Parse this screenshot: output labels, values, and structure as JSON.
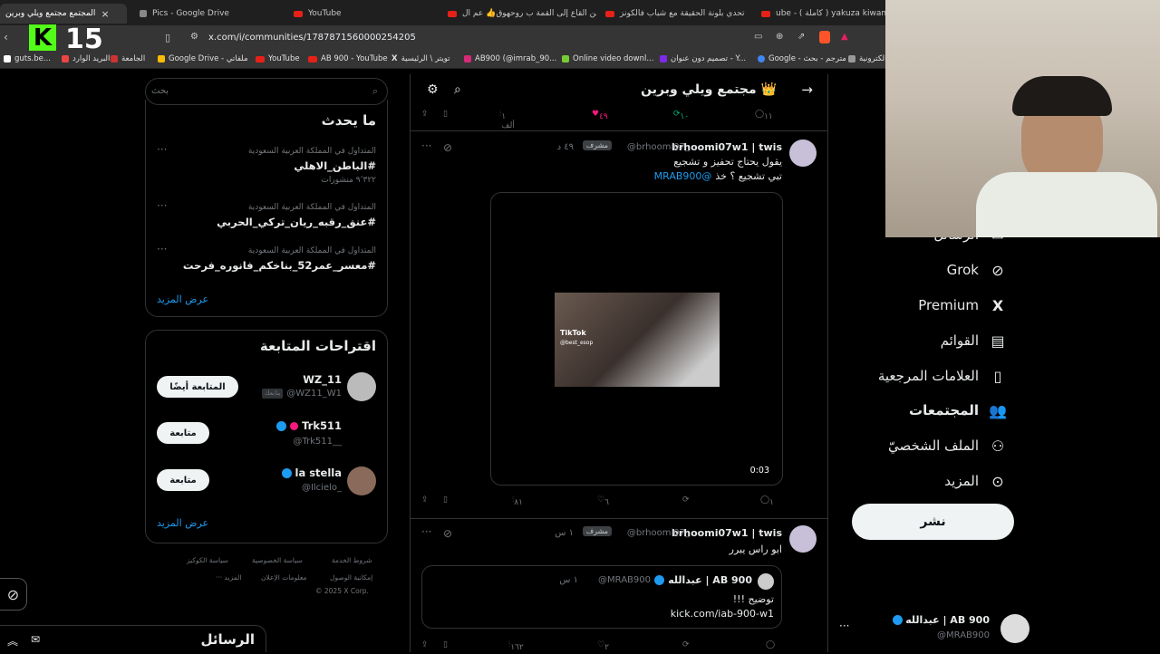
{
  "browser": {
    "tabs": [
      {
        "label": "المجتمع مجتمع ويلي وبرين",
        "active": true
      },
      {
        "label": "Pics - Google Drive"
      },
      {
        "label": "YouTube"
      },
      {
        "label": "من القاع إلى القمة ب روحهوق👍 عم ال"
      },
      {
        "label": "تحدي بلونة الحقيقة مع شباب فالكونز"
      },
      {
        "label": "ube - ( كاملة ) yakuza kiwami"
      }
    ],
    "url": "x.com/i/communities/1787871560000254205",
    "bookmarks": [
      "guts.be...",
      "البريد الوارد",
      "الجامعة",
      "Google Drive - ملفاتي",
      "YouTube",
      "AB 900 - YouTube",
      "تويتر \\ الرئيسية",
      "AB900 (@imrab_90...",
      "Online video downl...",
      "تصميم دون عنوان - Y...",
      "Google - مترجم - بحث",
      "الكترونية"
    ],
    "kick_badge": "K",
    "kick_count": "15"
  },
  "sidebar_right": {
    "search_placeholder": "بحث",
    "trending_title": "ما يحدث",
    "trends": [
      {
        "meta": "المتداول في المملكة العربية السعودية",
        "tag": "#الباطن_الاهلي",
        "count": "٩٬٣٢٢ منشورات"
      },
      {
        "meta": "المتداول في المملكة العربية السعودية",
        "tag": "#عنق_رقبه_ريان_تركي_الحربي",
        "count": ""
      },
      {
        "meta": "المتداول في المملكة العربية السعودية",
        "tag": "#معسر_عمر52_بناخكم_فانوره_فرحت",
        "count": ""
      }
    ],
    "show_more": "عرض المزيد",
    "suggest_title": "اقتراحات المتابعة",
    "suggestions": [
      {
        "name": "WZ_11",
        "handle": "@WZ11_W1",
        "follows_you": "يتابعك",
        "button": "المتابعة أيضًا"
      },
      {
        "name": "Trk511",
        "handle": "@Trk511__",
        "button": "متابعة"
      },
      {
        "name": "la stella",
        "handle": "@Ilcielo_",
        "button": "متابعة"
      }
    ],
    "show_more2": "عرض المزيد",
    "footer": [
      "شروط الخدمة",
      "سياسة الخصوصية",
      "سياسة الكوكيز",
      "إمكانية الوصول",
      "معلومات الإعلان",
      "··· المزيد",
      "© 2025 X Corp."
    ]
  },
  "feed": {
    "community_title": "مجتمع ويلي وبرين",
    "crown": "👑",
    "top_actions": {
      "replies": "١١",
      "reposts": "١٠",
      "likes": "٤٩",
      "views": "١ ألف"
    },
    "post1": {
      "name": "brhoomi07w1 | twis",
      "handle": "@brhoomi07_",
      "badge": "مشرف",
      "time": "٤٩ د",
      "line1": "يقول يحتاج تحفيز و تشجيع",
      "line2": "تبي تشجيع ؟ خذ",
      "mention": "@MRAB900",
      "video_duration": "0:03",
      "tiktok_label": "TikTok",
      "tiktok_user": "@best_esop",
      "actions": {
        "replies": "١",
        "reposts": "",
        "likes": "٦",
        "views": "٨١"
      }
    },
    "post2": {
      "name": "brhoomi07w1 | twis",
      "handle": "@brhoomi07_",
      "badge": "مشرف",
      "time": "١ س",
      "text": "ابو راس يبرر",
      "quote": {
        "name": "عبدالله | AB 900",
        "handle": "@MRAB900",
        "time": "١ س",
        "line1": "توضيح !!!",
        "link": "kick.com/iab-900-w1"
      },
      "actions": {
        "replies": "",
        "reposts": "",
        "likes": "٢",
        "views": "١٦٢"
      }
    }
  },
  "leftnav": {
    "items": [
      {
        "label": "الرسائل",
        "icon": "mail-icon"
      },
      {
        "label": "Grok",
        "icon": "grok-icon"
      },
      {
        "label": "Premium",
        "icon": "x-logo-icon"
      },
      {
        "label": "القوائم",
        "icon": "list-icon"
      },
      {
        "label": "العلامات المرجعية",
        "icon": "bookmark-icon"
      },
      {
        "label": "المجتمعات",
        "icon": "communities-icon"
      },
      {
        "label": "الملف الشخصيّ",
        "icon": "profile-icon"
      },
      {
        "label": "المزيد",
        "icon": "more-icon"
      }
    ],
    "post_button": "نشر",
    "account_name": "عبدالله | AB 900",
    "account_handle": "@MRAB900"
  },
  "messages_bar": {
    "title": "الرسائل"
  }
}
